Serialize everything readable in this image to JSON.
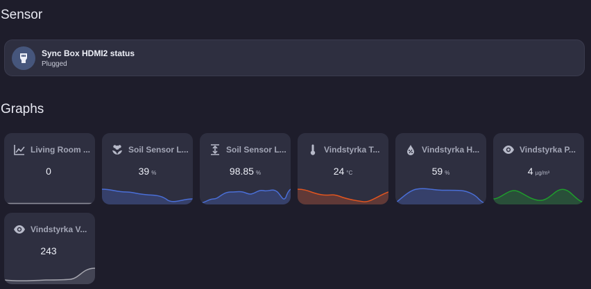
{
  "sensor_section": {
    "title": "Sensor",
    "entity": {
      "name": "Sync Box HDMI2 status",
      "state": "Plugged",
      "icon": "hdmi-port-icon"
    }
  },
  "graphs_section": {
    "title": "Graphs",
    "cards": [
      {
        "name": "Living Room ...",
        "value": "0",
        "unit": "",
        "icon": "chart-line-icon",
        "color": "#9a9aa6"
      },
      {
        "name": "Soil Sensor L...",
        "value": "39",
        "unit": "%",
        "icon": "flower-icon",
        "color": "#4a6fd8"
      },
      {
        "name": "Soil Sensor L...",
        "value": "98.85",
        "unit": "%",
        "icon": "arrow-expand-vertical-icon",
        "color": "#4a6fd8"
      },
      {
        "name": "Vindstyrka T...",
        "value": "24",
        "unit": "°C",
        "icon": "thermometer-icon",
        "color": "#e2551f"
      },
      {
        "name": "Vindstyrka H...",
        "value": "59",
        "unit": "%",
        "icon": "water-percent-icon",
        "color": "#4a6fd8"
      },
      {
        "name": "Vindstyrka P...",
        "value": "4",
        "unit": "µg/m³",
        "icon": "eye-icon",
        "color": "#1f9d2c"
      },
      {
        "name": "Vindstyrka V...",
        "value": "243",
        "unit": "",
        "icon": "eye-icon",
        "color": "#a7a7b0"
      }
    ]
  }
}
